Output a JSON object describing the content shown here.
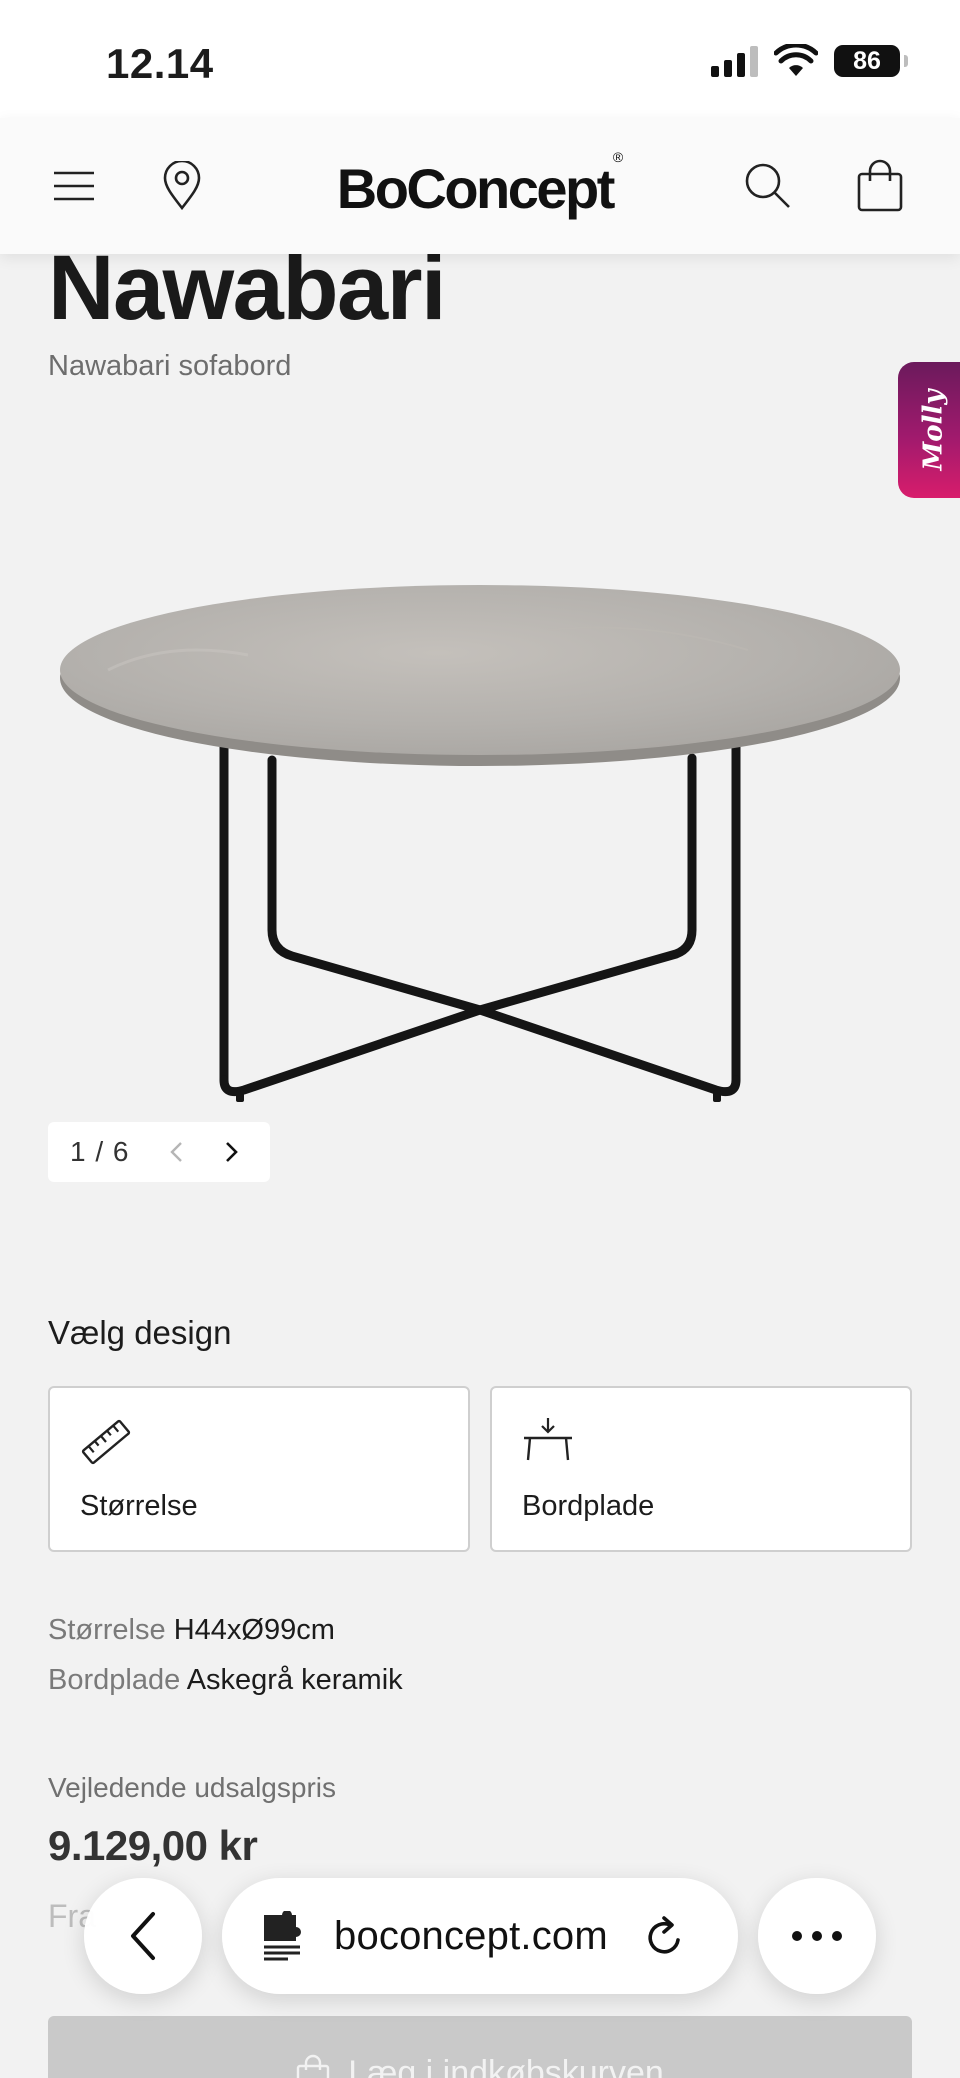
{
  "status_bar": {
    "time": "12.14",
    "battery": "86"
  },
  "header": {
    "logo": "BoConcept",
    "logo_mark": "®"
  },
  "product": {
    "title": "Nawabari",
    "subtitle": "Nawabari sofabord"
  },
  "chat": {
    "label": "Molly"
  },
  "gallery": {
    "counter": "1 / 6"
  },
  "design": {
    "heading": "Vælg design",
    "options": [
      {
        "label": "Størrelse",
        "icon": "ruler-icon"
      },
      {
        "label": "Bordplade",
        "icon": "table-top-icon"
      }
    ]
  },
  "specs": [
    {
      "key": "Størrelse",
      "value": "H44xØ99cm"
    },
    {
      "key": "Bordplade",
      "value": "Askegrå keramik"
    }
  ],
  "pricing": {
    "label": "Vejledende udsalgspris",
    "price": "9.129,00 kr",
    "from_partial": "Fra"
  },
  "cart_button": {
    "label": "Læg i indkøbskurven"
  },
  "browser": {
    "url": "boconcept.com"
  },
  "colors": {
    "molly_start": "#6b1a5c",
    "molly_end": "#d81d6c",
    "background": "#f2f2f2"
  }
}
